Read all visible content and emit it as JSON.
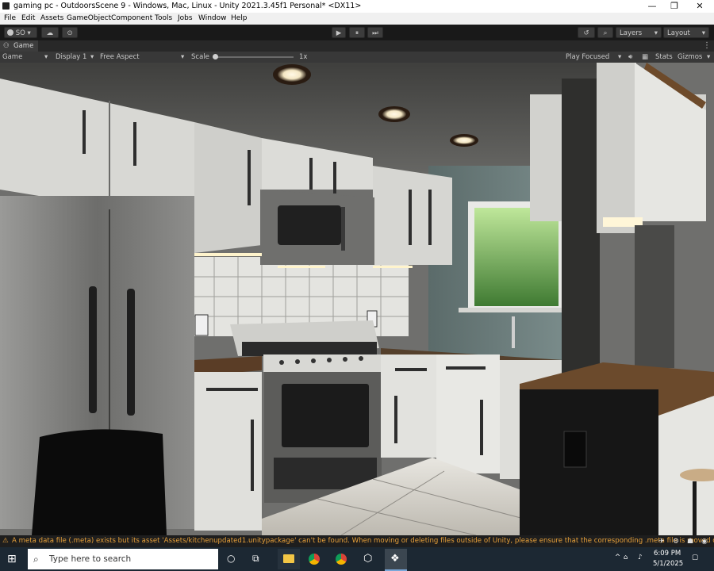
{
  "window": {
    "title": "gaming pc - OutdoorsScene 9 - Windows, Mac, Linux - Unity 2021.3.45f1 Personal* <DX11>",
    "minimize_glyph": "—",
    "restore_glyph": "❐",
    "close_glyph": "✕"
  },
  "menu": {
    "items": [
      "File",
      "Edit",
      "Assets",
      "GameObject",
      "Component",
      "Tools",
      "Jobs",
      "Window",
      "Help"
    ]
  },
  "toolbar": {
    "account_label": "SO",
    "layers_label": "Layers",
    "layout_label": "Layout",
    "play_glyph": "▶",
    "pause_glyph": "⏸",
    "step_glyph": "⏭",
    "history_icon": "history-icon",
    "search_icon": "search-icon"
  },
  "game_tab": {
    "label": "Game",
    "menu_glyph": "⋮"
  },
  "game_toolbar": {
    "view_select": "Game",
    "display_select": "Display 1",
    "aspect_select": "Free Aspect",
    "scale_label": "Scale",
    "scale_value": "1x",
    "play_mode": "Play Focused",
    "stats_label": "Stats",
    "gizmos_label": "Gizmos"
  },
  "status": {
    "warning_icon": "warning-icon",
    "message": "A meta data file (.meta) exists but its asset 'Assets/kitchenupdated1.unitypackage' can't be found. When moving or deleting files outside of Unity, please ensure that the corresponding .meta file is moved o"
  },
  "taskbar": {
    "search_placeholder": "Type here to search",
    "time": "6:09 PM",
    "date": "5/1/2025",
    "apps": [
      "file-explorer-icon",
      "chrome-icon",
      "chrome-icon",
      "unity-hub-icon",
      "unity-icon"
    ]
  },
  "colors": {
    "warning": "#e8a13a",
    "taskbar": "#1c2833",
    "toolbar": "#191919"
  }
}
